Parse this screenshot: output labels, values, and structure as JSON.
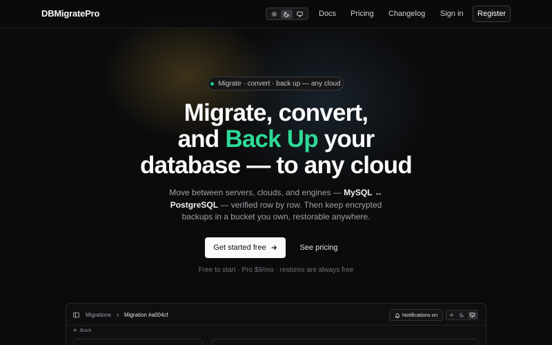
{
  "nav": {
    "brand": "DBMigratePro",
    "theme_options": [
      "light",
      "dark",
      "system"
    ],
    "theme_selected": "dark",
    "links": [
      "Docs",
      "Pricing",
      "Changelog",
      "Sign in"
    ],
    "register_label": "Register"
  },
  "hero": {
    "badge_text": "Migrate · convert · back up — any cloud",
    "headline_line1": "Migrate, convert,",
    "headline_and": "and ",
    "headline_accent": "Back Up",
    "headline_your": " your",
    "headline_line3": "database — to any cloud",
    "sub_part1": "Move between servers, clouds, and engines — ",
    "sub_bold1": "MySQL ↔",
    "sub_bold2": "PostgreSQL",
    "sub_part2": " — verified row by row. Then keep encrypted backups in a bucket you own, restorable anywhere.",
    "cta_primary": "Get started free",
    "cta_secondary": "See pricing",
    "fineprint": "Free to start · Pro $9/mo · restores are always free"
  },
  "preview": {
    "crumb_root": "Migrations",
    "crumb_current": "Migration #a004cf",
    "notifications_label": "Notifications on",
    "theme_selected": "system",
    "back_label": "Back"
  },
  "colors": {
    "accent": "#2fd996",
    "background": "#0b0b0c",
    "badge_dot": "#22c98a"
  },
  "icons": {
    "theme": [
      "sun-icon",
      "moon-icon",
      "monitor-icon"
    ],
    "cta_arrow": "arrow-right-icon",
    "sidebar_toggle": "sidebar-icon",
    "crumb_separator": "chevron-right-icon",
    "notifications": "bell-icon",
    "back": "arrow-left-icon"
  }
}
